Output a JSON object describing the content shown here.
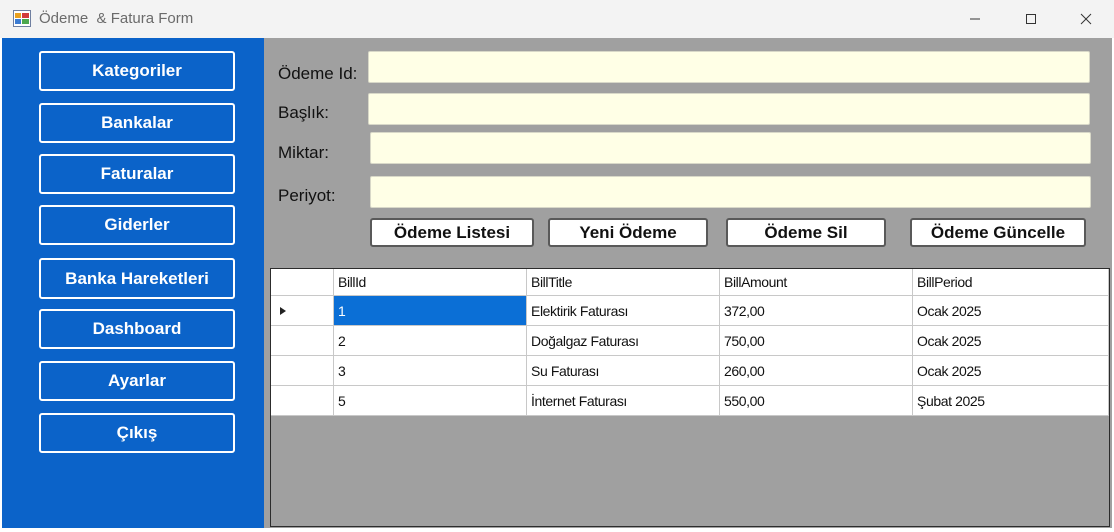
{
  "window": {
    "title": "Ödeme  & Fatura Form",
    "controls": {
      "minimize": "minimize-icon",
      "maximize": "maximize-icon",
      "close": "close-icon"
    }
  },
  "sidebar": {
    "items": [
      {
        "label": "Kategoriler"
      },
      {
        "label": "Bankalar"
      },
      {
        "label": "Faturalar"
      },
      {
        "label": "Giderler"
      },
      {
        "label": "Banka Hareketleri"
      },
      {
        "label": "Dashboard"
      },
      {
        "label": "Ayarlar"
      },
      {
        "label": "Çıkış"
      }
    ]
  },
  "form": {
    "id_label": "Ödeme Id:",
    "title_label": "Başlık:",
    "amount_label": "Miktar:",
    "period_label": "Periyot:",
    "id_value": "",
    "title_value": "",
    "amount_value": "",
    "period_value": ""
  },
  "actions": {
    "list": "Ödeme Listesi",
    "new": "Yeni Ödeme",
    "delete": "Ödeme Sil",
    "update": "Ödeme Güncelle"
  },
  "grid": {
    "columns": [
      "BillId",
      "BillTitle",
      "BillAmount",
      "BillPeriod"
    ],
    "rows": [
      [
        "1",
        "Elektirik Faturası",
        "372,00",
        "Ocak 2025"
      ],
      [
        "2",
        "Doğalgaz Faturası",
        "750,00",
        "Ocak 2025"
      ],
      [
        "3",
        "Su Faturası",
        "260,00",
        "Ocak 2025"
      ],
      [
        "5",
        "İnternet Faturası",
        "550,00",
        "Şubat 2025"
      ]
    ]
  },
  "colors": {
    "sidebar": "#0b63c9",
    "content_bg": "#a0a0a0",
    "field_bg": "#ffffe6",
    "selection": "#0b6fd6"
  }
}
